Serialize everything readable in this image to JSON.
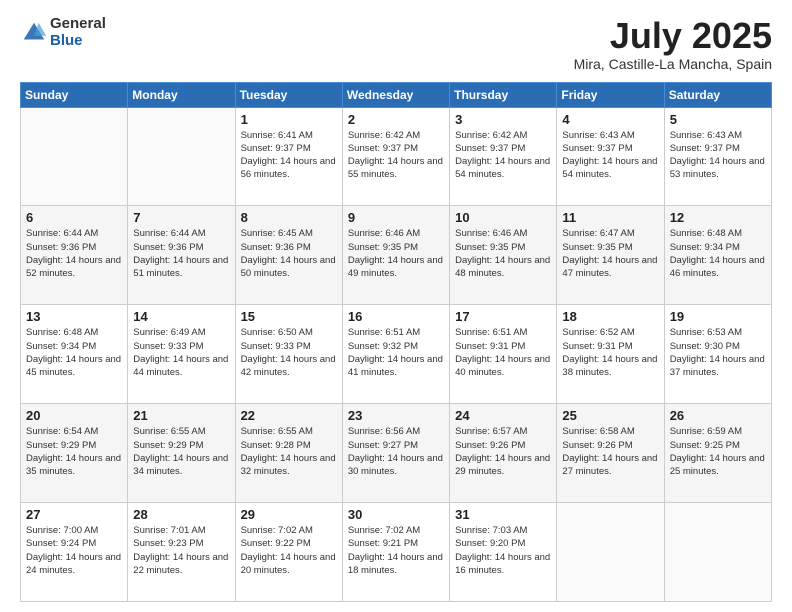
{
  "header": {
    "logo_general": "General",
    "logo_blue": "Blue",
    "month": "July 2025",
    "location": "Mira, Castille-La Mancha, Spain"
  },
  "weekdays": [
    "Sunday",
    "Monday",
    "Tuesday",
    "Wednesday",
    "Thursday",
    "Friday",
    "Saturday"
  ],
  "weeks": [
    [
      {
        "day": "",
        "info": ""
      },
      {
        "day": "",
        "info": ""
      },
      {
        "day": "1",
        "info": "Sunrise: 6:41 AM\nSunset: 9:37 PM\nDaylight: 14 hours and 56 minutes."
      },
      {
        "day": "2",
        "info": "Sunrise: 6:42 AM\nSunset: 9:37 PM\nDaylight: 14 hours and 55 minutes."
      },
      {
        "day": "3",
        "info": "Sunrise: 6:42 AM\nSunset: 9:37 PM\nDaylight: 14 hours and 54 minutes."
      },
      {
        "day": "4",
        "info": "Sunrise: 6:43 AM\nSunset: 9:37 PM\nDaylight: 14 hours and 54 minutes."
      },
      {
        "day": "5",
        "info": "Sunrise: 6:43 AM\nSunset: 9:37 PM\nDaylight: 14 hours and 53 minutes."
      }
    ],
    [
      {
        "day": "6",
        "info": "Sunrise: 6:44 AM\nSunset: 9:36 PM\nDaylight: 14 hours and 52 minutes."
      },
      {
        "day": "7",
        "info": "Sunrise: 6:44 AM\nSunset: 9:36 PM\nDaylight: 14 hours and 51 minutes."
      },
      {
        "day": "8",
        "info": "Sunrise: 6:45 AM\nSunset: 9:36 PM\nDaylight: 14 hours and 50 minutes."
      },
      {
        "day": "9",
        "info": "Sunrise: 6:46 AM\nSunset: 9:35 PM\nDaylight: 14 hours and 49 minutes."
      },
      {
        "day": "10",
        "info": "Sunrise: 6:46 AM\nSunset: 9:35 PM\nDaylight: 14 hours and 48 minutes."
      },
      {
        "day": "11",
        "info": "Sunrise: 6:47 AM\nSunset: 9:35 PM\nDaylight: 14 hours and 47 minutes."
      },
      {
        "day": "12",
        "info": "Sunrise: 6:48 AM\nSunset: 9:34 PM\nDaylight: 14 hours and 46 minutes."
      }
    ],
    [
      {
        "day": "13",
        "info": "Sunrise: 6:48 AM\nSunset: 9:34 PM\nDaylight: 14 hours and 45 minutes."
      },
      {
        "day": "14",
        "info": "Sunrise: 6:49 AM\nSunset: 9:33 PM\nDaylight: 14 hours and 44 minutes."
      },
      {
        "day": "15",
        "info": "Sunrise: 6:50 AM\nSunset: 9:33 PM\nDaylight: 14 hours and 42 minutes."
      },
      {
        "day": "16",
        "info": "Sunrise: 6:51 AM\nSunset: 9:32 PM\nDaylight: 14 hours and 41 minutes."
      },
      {
        "day": "17",
        "info": "Sunrise: 6:51 AM\nSunset: 9:31 PM\nDaylight: 14 hours and 40 minutes."
      },
      {
        "day": "18",
        "info": "Sunrise: 6:52 AM\nSunset: 9:31 PM\nDaylight: 14 hours and 38 minutes."
      },
      {
        "day": "19",
        "info": "Sunrise: 6:53 AM\nSunset: 9:30 PM\nDaylight: 14 hours and 37 minutes."
      }
    ],
    [
      {
        "day": "20",
        "info": "Sunrise: 6:54 AM\nSunset: 9:29 PM\nDaylight: 14 hours and 35 minutes."
      },
      {
        "day": "21",
        "info": "Sunrise: 6:55 AM\nSunset: 9:29 PM\nDaylight: 14 hours and 34 minutes."
      },
      {
        "day": "22",
        "info": "Sunrise: 6:55 AM\nSunset: 9:28 PM\nDaylight: 14 hours and 32 minutes."
      },
      {
        "day": "23",
        "info": "Sunrise: 6:56 AM\nSunset: 9:27 PM\nDaylight: 14 hours and 30 minutes."
      },
      {
        "day": "24",
        "info": "Sunrise: 6:57 AM\nSunset: 9:26 PM\nDaylight: 14 hours and 29 minutes."
      },
      {
        "day": "25",
        "info": "Sunrise: 6:58 AM\nSunset: 9:26 PM\nDaylight: 14 hours and 27 minutes."
      },
      {
        "day": "26",
        "info": "Sunrise: 6:59 AM\nSunset: 9:25 PM\nDaylight: 14 hours and 25 minutes."
      }
    ],
    [
      {
        "day": "27",
        "info": "Sunrise: 7:00 AM\nSunset: 9:24 PM\nDaylight: 14 hours and 24 minutes."
      },
      {
        "day": "28",
        "info": "Sunrise: 7:01 AM\nSunset: 9:23 PM\nDaylight: 14 hours and 22 minutes."
      },
      {
        "day": "29",
        "info": "Sunrise: 7:02 AM\nSunset: 9:22 PM\nDaylight: 14 hours and 20 minutes."
      },
      {
        "day": "30",
        "info": "Sunrise: 7:02 AM\nSunset: 9:21 PM\nDaylight: 14 hours and 18 minutes."
      },
      {
        "day": "31",
        "info": "Sunrise: 7:03 AM\nSunset: 9:20 PM\nDaylight: 14 hours and 16 minutes."
      },
      {
        "day": "",
        "info": ""
      },
      {
        "day": "",
        "info": ""
      }
    ]
  ]
}
